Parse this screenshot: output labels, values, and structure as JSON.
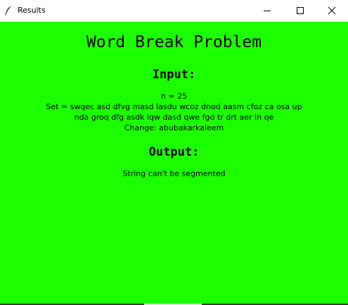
{
  "window": {
    "title": "Results",
    "controls": {
      "minimize": "minimize-icon",
      "maximize": "maximize-icon",
      "close": "close-icon"
    }
  },
  "content": {
    "background": "#1cff00",
    "title": "Word Break Problem",
    "input_heading": "Input:",
    "n_line": "n = 25",
    "set_line_1": "Set = swqec asd dfvg masd lasdu wcoz dnod aasm cfoz ca osa up",
    "set_line_2": "nda groq dfg asdk lqw dasd qwe fgd tr drt aer ln qe",
    "change_line": "Change: abubakarkaleem",
    "output_heading": "Output:",
    "result": "String can't be segmented"
  }
}
